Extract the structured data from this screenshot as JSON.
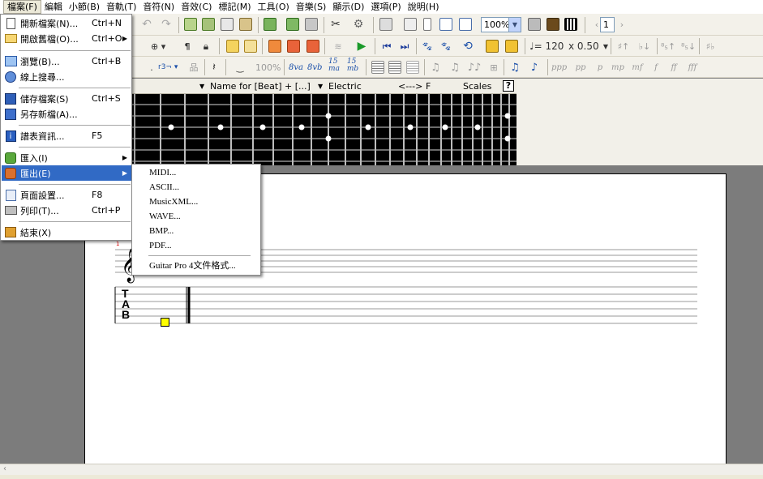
{
  "menubar": {
    "items": [
      "檔案(F)",
      "編輯",
      "小節(B)",
      "音軌(T)",
      "音符(N)",
      "音效(C)",
      "標記(M)",
      "工具(O)",
      "音樂(S)",
      "顯示(D)",
      "選項(P)",
      "說明(H)"
    ]
  },
  "toolbar": {
    "zoom": "100%",
    "page_number": "1",
    "tempo": "♩= 120",
    "speed": "x 0.50",
    "percent": "100%",
    "octave_8va": "8va",
    "octave_8vb": "8vb",
    "octave_15ma": "15\nma",
    "octave_15mb": "15\nmb",
    "dyn_ppp": "ppp",
    "dyn_pp": "pp",
    "dyn_p": "p",
    "dyn_mp": "mp",
    "dyn_mf": "mf",
    "dyn_f": "f",
    "dyn_ff": "ff",
    "dyn_fff": "fff"
  },
  "track_header": {
    "name_col": "Name for [Beat] + [...]",
    "instrument": "Electric",
    "arrows": "<--->",
    "key": "F",
    "scales": "Scales",
    "help": "?"
  },
  "file_menu": {
    "items": [
      {
        "label": "開新檔案(N)...",
        "shortcut": "Ctrl+N",
        "submenu": false,
        "icon": "new-file-icon"
      },
      {
        "label": "開啟舊檔(O)...",
        "shortcut": "Ctrl+O",
        "submenu": true,
        "icon": "open-folder-icon"
      },
      {
        "label": "瀏覽(B)...",
        "shortcut": "Ctrl+B",
        "submenu": false,
        "icon": "browse-icon"
      },
      {
        "label": "線上搜尋...",
        "shortcut": "",
        "submenu": false,
        "icon": "search-online-icon"
      },
      {
        "label": "儲存檔案(S)",
        "shortcut": "Ctrl+S",
        "submenu": false,
        "icon": "save-icon"
      },
      {
        "label": "另存新檔(A)...",
        "shortcut": "",
        "submenu": false,
        "icon": "save-as-icon"
      },
      {
        "label": "譜表資訊...",
        "shortcut": "F5",
        "submenu": false,
        "icon": "info-icon"
      },
      {
        "label": "匯入(I)",
        "shortcut": "",
        "submenu": true,
        "icon": "import-icon"
      },
      {
        "label": "匯出(E)",
        "shortcut": "",
        "submenu": true,
        "icon": "export-icon"
      },
      {
        "label": "頁面設置...",
        "shortcut": "F8",
        "submenu": false,
        "icon": "page-setup-icon"
      },
      {
        "label": "列印(T)...",
        "shortcut": "Ctrl+P",
        "submenu": false,
        "icon": "print-icon"
      },
      {
        "label": "結束(X)",
        "shortcut": "",
        "submenu": false,
        "icon": "exit-icon"
      }
    ]
  },
  "export_submenu": {
    "items": [
      "MIDI...",
      "ASCII...",
      "MusicXML...",
      "WAVE...",
      "BMP...",
      "PDF...",
      "Guitar Pro 4文件格式..."
    ]
  },
  "score": {
    "measure_number": "1",
    "tab_letters": [
      "T",
      "A",
      "B"
    ]
  },
  "colors": {
    "menu_highlight": "#316ac5",
    "toolbar_bg": "#f3f1ea",
    "workspace_bg": "#7c7c7c",
    "fretboard_bg": "#000000",
    "cursor_yellow": "#ffff00"
  }
}
